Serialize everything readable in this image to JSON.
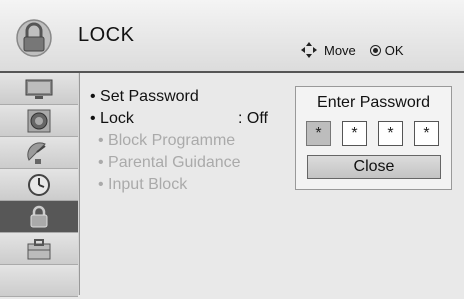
{
  "header": {
    "icon": "lock-icon",
    "title": "LOCK",
    "move_label": "Move",
    "ok_label": "OK"
  },
  "sidebar": {
    "items": [
      {
        "icon": "tv-picture-icon",
        "active": false
      },
      {
        "icon": "speaker-audio-icon",
        "active": false
      },
      {
        "icon": "satellite-dish-icon",
        "active": false
      },
      {
        "icon": "clock-icon",
        "active": false
      },
      {
        "icon": "lock-icon",
        "active": true
      },
      {
        "icon": "toolbox-icon",
        "active": false
      }
    ]
  },
  "menu": {
    "set_password": "• Set Password",
    "lock": "• Lock",
    "lock_value": ": Off",
    "block_programme": "• Block Programme",
    "parental_guidance": "• Parental Guidance",
    "input_block": "• Input Block"
  },
  "password_dialog": {
    "title": "Enter Password",
    "digits": [
      "*",
      "*",
      "*",
      "*"
    ],
    "close_label": "Close"
  },
  "colors": {
    "active_sidebar": "#575757",
    "disabled_text": "#aaaaaa"
  }
}
